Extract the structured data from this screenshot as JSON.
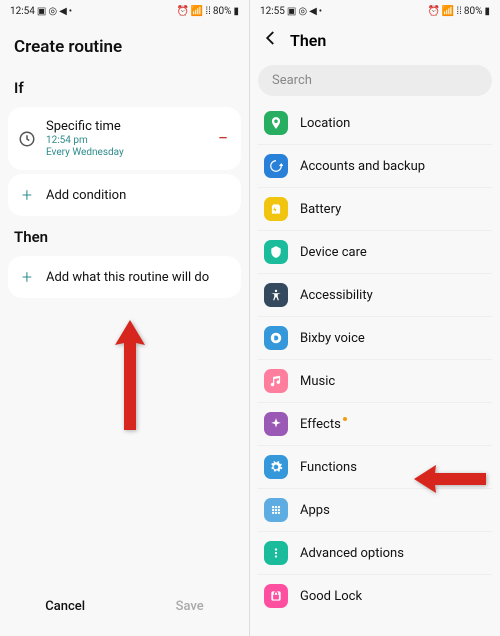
{
  "left": {
    "status": {
      "time": "12:54",
      "battery": "80%"
    },
    "title": "Create routine",
    "if_label": "If",
    "specific_time": {
      "title": "Specific time",
      "time": "12:54 pm",
      "repeat": "Every Wednesday"
    },
    "add_condition": "Add condition",
    "then_label": "Then",
    "add_action": "Add what this routine will do",
    "cancel": "Cancel",
    "save": "Save"
  },
  "right": {
    "status": {
      "time": "12:55",
      "battery": "80%"
    },
    "title": "Then",
    "search": "Search",
    "items": [
      {
        "label": "Location",
        "color": "#27ae60"
      },
      {
        "label": "Accounts and backup",
        "color": "#2980d9"
      },
      {
        "label": "Battery",
        "color": "#f1c40f"
      },
      {
        "label": "Device care",
        "color": "#1abc9c"
      },
      {
        "label": "Accessibility",
        "color": "#34495e"
      },
      {
        "label": "Bixby voice",
        "color": "#3498db"
      },
      {
        "label": "Music",
        "color": "#ff7e9e"
      },
      {
        "label": "Effects",
        "color": "#9b59b6",
        "dot": true
      },
      {
        "label": "Functions",
        "color": "#3498db"
      },
      {
        "label": "Apps",
        "color": "#5dade2"
      },
      {
        "label": "Advanced options",
        "color": "#1abc9c"
      },
      {
        "label": "Good Lock",
        "color": "#ff4fa0"
      }
    ]
  }
}
